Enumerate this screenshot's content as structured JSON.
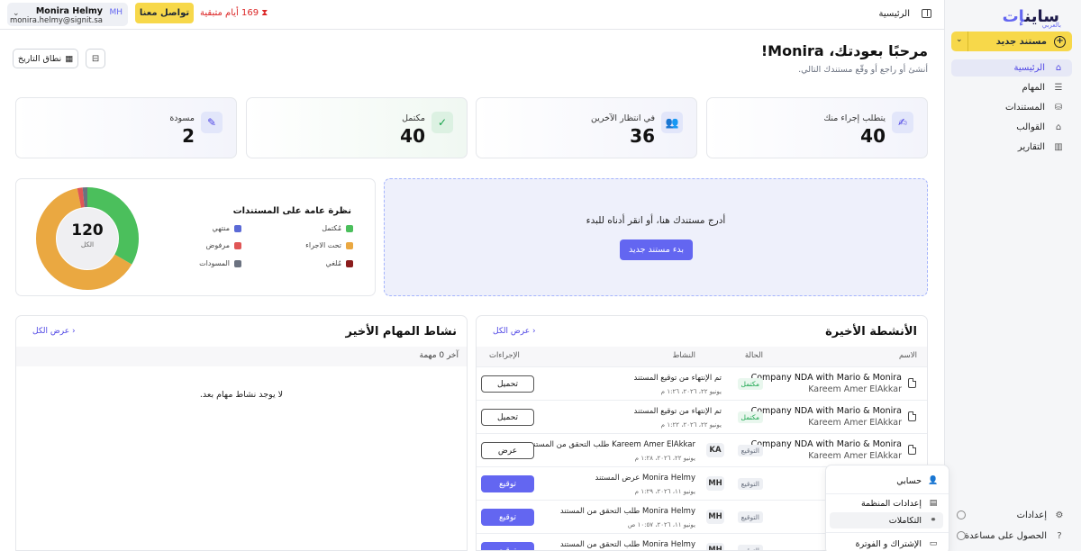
{
  "sidebar": {
    "logo_main": "ساين",
    "logo_accent": "إت",
    "logo_sub": "بالعربي",
    "new_doc": "مستند جديد",
    "items": [
      {
        "label": "الرئيسية",
        "icon": "home-icon"
      },
      {
        "label": "المهام",
        "icon": "tasks-icon"
      },
      {
        "label": "المستندات",
        "icon": "documents-icon"
      },
      {
        "label": "القوالب",
        "icon": "templates-icon"
      },
      {
        "label": "التقارير",
        "icon": "reports-icon"
      }
    ],
    "settings": "إعدادات",
    "help": "الحصول على مساعدة"
  },
  "topbar": {
    "breadcrumb": "الرئيسية",
    "trial": "169 أيام متبقية",
    "contact": "تواصل معنا",
    "user_name": "Monira Helmy",
    "user_email": "monira.helmy@signit.sa",
    "user_initials": "MH"
  },
  "welcome": {
    "title": "مرحبًا بعودتك، Monira!",
    "subtitle": "أنشئ أو راجع أو وقّع مستندك التالي.",
    "date_range": "نطاق التاريخ"
  },
  "stats": [
    {
      "label": "يتطلب إجراء منك",
      "value": "40"
    },
    {
      "label": "في انتظار الآخرين",
      "value": "36"
    },
    {
      "label": "مكتمل",
      "value": "40"
    },
    {
      "label": "مسودة",
      "value": "2"
    }
  ],
  "upload": {
    "message": "أدرج مستندك هنا، أو انقر أدناه للبدء",
    "button": "بدء مستند جديد"
  },
  "overview": {
    "title": "نظرة عامة على المستندات",
    "total": "120",
    "total_label": "الكل",
    "legend": [
      {
        "label": "مُكتمل",
        "color": "#4bbf5c"
      },
      {
        "label": "تحت الاجراء",
        "color": "#eaa841"
      },
      {
        "label": "مُلغي",
        "color": "#8b1c1c"
      },
      {
        "label": "منتهي",
        "color": "#5b6ad6"
      },
      {
        "label": "مرفوض",
        "color": "#e05656"
      },
      {
        "label": "المسودات",
        "color": "#6b7280"
      }
    ]
  },
  "chart_data": {
    "type": "pie",
    "title": "نظرة عامة على المستندات",
    "categories": [
      "مُكتمل",
      "تحت الاجراء",
      "مُلغي",
      "منتهي",
      "مرفوض",
      "المسودات"
    ],
    "values": [
      40,
      76,
      0,
      0,
      2,
      2
    ],
    "total": 120
  },
  "activities": {
    "title": "الأنشطة الأخيرة",
    "view_all": "عرض الكل",
    "columns": [
      "الاسم",
      "الحالة",
      "النشاط",
      "الإجراءات"
    ],
    "rows": [
      {
        "name": "Company NDA with Mario & Monira",
        "by": "Kareem Amer ElAkkar",
        "status": "مكتمل",
        "status_kind": "done",
        "avatar": "",
        "activity": "تم الإنتهاء من توقيع المستند",
        "date": "يونيو ٢٢، ٢٠٢٦، ١:٢٦ م",
        "action": "تحميل",
        "action_kind": "outline"
      },
      {
        "name": "Company NDA with Mario & Monira",
        "by": "Kareem Amer ElAkkar",
        "status": "مكتمل",
        "status_kind": "done",
        "avatar": "",
        "activity": "تم الإنتهاء من توقيع المستند",
        "date": "يونيو ٢٢، ٢٠٢٦، ١:٢٢ م",
        "action": "تحميل",
        "action_kind": "outline"
      },
      {
        "name": "Company NDA with Mario & Monira",
        "by": "Kareem Amer ElAkkar",
        "status": "التوقيع",
        "status_kind": "sign",
        "avatar": "KA",
        "activity": "Kareem Amer ElAkkar طلب التحقق من المستند",
        "date": "يونيو ٢٢، ٢٠٢٦، ١:٢٨ م",
        "action": "عرض",
        "action_kind": "outline"
      },
      {
        "name": "",
        "by": "",
        "status": "التوقيع",
        "status_kind": "sign",
        "avatar": "MH",
        "activity": "Monira Helmy عرض المستند",
        "date": "يونيو ١١، ٢٠٢٦، ١:٢٩ م",
        "action": "توقيع",
        "action_kind": "primary"
      },
      {
        "name": "",
        "by": "",
        "status": "التوقيع",
        "status_kind": "sign",
        "avatar": "MH",
        "activity": "Monira Helmy طلب التحقق من المستند",
        "date": "يونيو ١١، ٢٠٢٦، ١٠:٥٧ ص",
        "action": "توقيع",
        "action_kind": "primary"
      },
      {
        "name": "",
        "by": "",
        "status": "التوقيع",
        "status_kind": "sign",
        "avatar": "MH",
        "activity": "Monira Helmy طلب التحقق من المستند",
        "date": "",
        "action": "توقيع",
        "action_kind": "primary"
      }
    ]
  },
  "tasks": {
    "title": "نشاط المهام الأخير",
    "view_all": "عرض الكل",
    "subheader": "آخر 0 مهمة",
    "empty": "لا يوجد نشاط مهام بعد."
  },
  "menu": {
    "items": [
      {
        "label": "حسابي",
        "icon": "user-icon"
      },
      {
        "label": "إعدادات المنظمة",
        "icon": "organization-icon"
      },
      {
        "label": "التكاملات",
        "icon": "integrations-icon"
      },
      {
        "label": "الإشتراك و الفوترة",
        "icon": "billing-icon"
      }
    ]
  }
}
